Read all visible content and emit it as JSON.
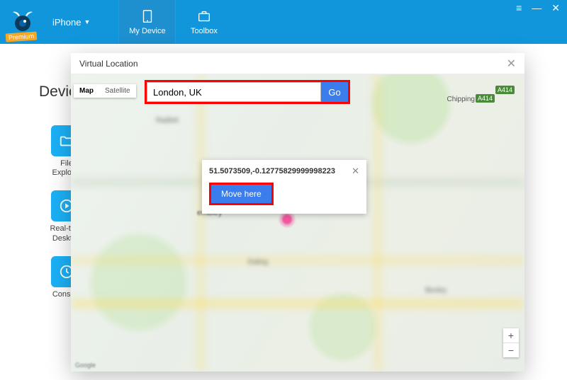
{
  "header": {
    "premium_label": "Premium",
    "device_selector": "iPhone",
    "tabs": {
      "my_device": "My Device",
      "toolbox": "Toolbox"
    },
    "window": {
      "menu": "≡",
      "min": "—",
      "close": "✕"
    }
  },
  "page": {
    "title": "Device"
  },
  "sidebar": {
    "file_explorer": "File\nExplorer",
    "realtime_desktop": "Real-time\nDesktop",
    "console": "Console"
  },
  "modal": {
    "title": "Virtual Location",
    "close": "✕",
    "map_type": {
      "map": "Map",
      "satellite": "Satellite"
    },
    "search_value": "London, UK",
    "go_label": "Go",
    "road_badge_1": "A414",
    "road_badge_2": "A414",
    "town_chipping": "Chipping",
    "town_ambley": "embley",
    "popup": {
      "coords": "51.5073509,-0.12775829999998223",
      "move_label": "Move here",
      "close": "✕"
    },
    "zoom": {
      "in": "+",
      "out": "−"
    },
    "google": "Google"
  }
}
